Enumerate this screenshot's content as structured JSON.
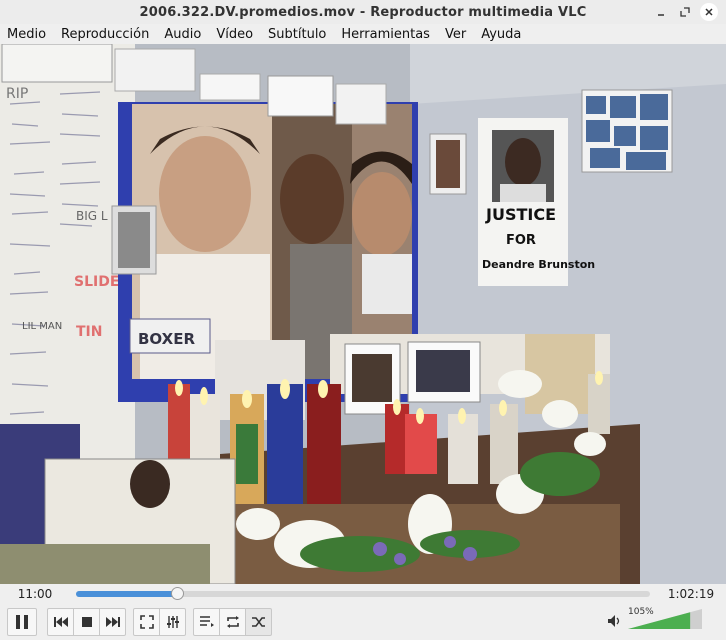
{
  "window": {
    "title": "2006.322.DV.promedios.mov - Reproductor multimedia VLC"
  },
  "menu": {
    "items": [
      "Medio",
      "Reproducción",
      "Audio",
      "Vídeo",
      "Subtítulo",
      "Herramientas",
      "Ver",
      "Ayuda"
    ]
  },
  "video": {
    "scene_text": {
      "justice": "JUSTICE",
      "for": "FOR",
      "name": "Deandre Brunston",
      "boxer": "BOXER",
      "rip": "RIP",
      "slide": "SLIDE",
      "tin": "TIN",
      "lil_man": "LIL MAN",
      "big_l": "BIG L"
    }
  },
  "playback": {
    "elapsed": "11:00",
    "total": "1:02:19",
    "progress": 0.176
  },
  "volume": {
    "percent_label": "105%",
    "level": 1.05,
    "accent": "#4caf50"
  },
  "colors": {
    "seek_fill": "#4a90d9",
    "ui_bg": "#efefef"
  }
}
